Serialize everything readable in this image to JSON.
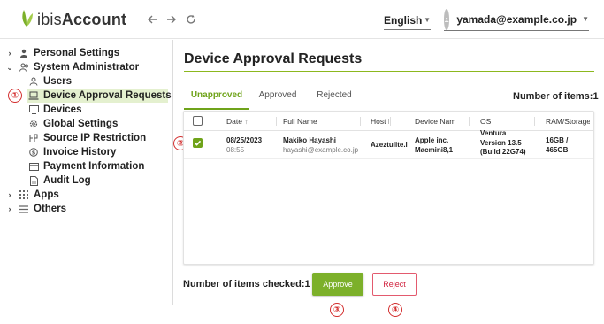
{
  "header": {
    "logo_prefix": "ibis",
    "logo_main": "Account",
    "back_icon": "arrow-left-icon",
    "forward_icon": "arrow-right-icon",
    "reload_icon": "reload-icon",
    "language": "English",
    "user_email": "yamada@example.co.jp"
  },
  "sidebar": {
    "items": [
      {
        "label": "Personal Settings",
        "icon": "person-icon"
      },
      {
        "label": "System Administrator",
        "icon": "people-icon"
      },
      {
        "label": "Users",
        "icon": "user-icon"
      },
      {
        "label": "Device Approval Requests",
        "icon": "laptop-icon",
        "active": true
      },
      {
        "label": "Devices",
        "icon": "monitor-icon"
      },
      {
        "label": "Global Settings",
        "icon": "gear-icon"
      },
      {
        "label": "Source IP Restriction",
        "icon": "ip-restriction-icon"
      },
      {
        "label": "Invoice History",
        "icon": "dollar-icon"
      },
      {
        "label": "Payment Information",
        "icon": "credit-card-icon"
      },
      {
        "label": "Audit Log",
        "icon": "document-icon"
      },
      {
        "label": "Apps",
        "icon": "grid-icon"
      },
      {
        "label": "Others",
        "icon": "menu-icon"
      }
    ]
  },
  "main": {
    "title": "Device Approval Requests",
    "tabs": [
      {
        "label": "Unapproved",
        "active": true
      },
      {
        "label": "Approved"
      },
      {
        "label": "Rejected"
      }
    ],
    "item_count": "Number of items:1",
    "columns": [
      "Date",
      "Full Name",
      "Host I",
      "Device Name",
      "OS",
      "RAM/Storage"
    ],
    "sort_icon": "arrow-up-icon",
    "rows": [
      {
        "checked": true,
        "date": "08/25/2023",
        "time": "08:55",
        "full_name": "Makiko Hayashi",
        "email": "hayashi@example.co.jp",
        "host": "Azeztulite.l",
        "device_line1": "Apple inc.",
        "device_line2": "Macmini8,1",
        "os_line1": "Ventura",
        "os_line2": "Version 13.5",
        "os_line3": "(Build 22G74)",
        "ram_line1": "16GB /",
        "ram_line2": "465GB"
      }
    ],
    "checked_count": "Number of items checked:1",
    "approve_label": "Approve",
    "reject_label": "Reject"
  },
  "markers": [
    "①",
    "②",
    "③",
    "④"
  ],
  "colors": {
    "accent": "#6fa31a",
    "approve": "#7cb02a",
    "reject": "#d0203c",
    "active_bg": "#e4f0cf",
    "marker": "#d32f2f"
  }
}
